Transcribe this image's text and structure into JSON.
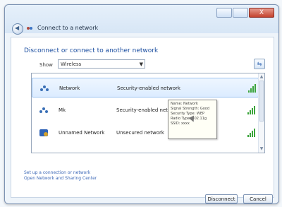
{
  "window": {
    "title": "Connect to a network",
    "close_label": "X"
  },
  "main": {
    "heading": "Disconnect or connect to another network",
    "show_label": "Show",
    "show_selected": "Wireless"
  },
  "networks": [
    {
      "name": "Network",
      "security": "Security-enabled network",
      "signal_level": 4
    },
    {
      "name": "Mk",
      "security": "Security-enabled network",
      "signal_level": 4
    },
    {
      "name": "Unnamed Network",
      "security": "Unsecured network",
      "signal_level": 4
    }
  ],
  "tooltip": {
    "lines": [
      "Name: Network",
      "Signal Strength: Good",
      "Security Type: WEP",
      "Radio Type: 802.11g",
      "SSID: xxxx"
    ]
  },
  "links": {
    "setup": "Set up a connection or network",
    "center": "Open Network and Sharing Center"
  },
  "buttons": {
    "disconnect": "Disconnect",
    "cancel": "Cancel"
  },
  "icons": {
    "back": "back-arrow-icon",
    "nav": "network-icon",
    "refresh": "refresh-icon",
    "wireless": "wireless-network-icon",
    "signal": "signal-strength-icon"
  },
  "colors": {
    "accent": "#1b4ea0",
    "signal": "#3aa43a",
    "link": "#3c68b7"
  }
}
